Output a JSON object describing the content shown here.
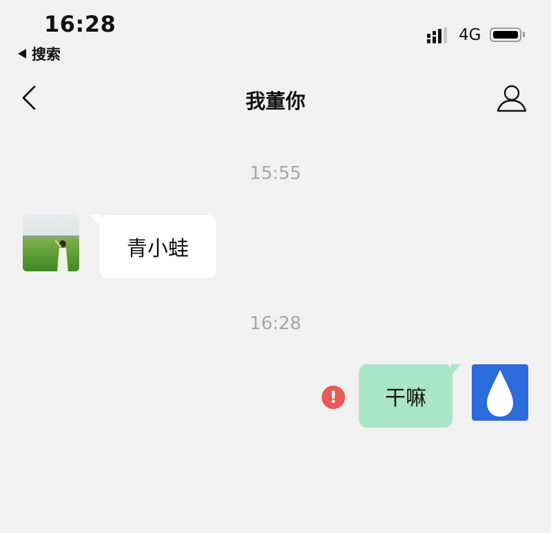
{
  "status_bar": {
    "time": "16:28",
    "back_app_label": "搜索",
    "network": "4G"
  },
  "nav": {
    "title": "我董你"
  },
  "messages": [
    {
      "type": "timestamp",
      "text": "15:55"
    },
    {
      "type": "incoming",
      "text": "青小蛙",
      "avatar": "photo-avatar"
    },
    {
      "type": "timestamp",
      "text": "16:28"
    },
    {
      "type": "outgoing",
      "text": "干嘛",
      "status": "failed",
      "avatar": "water-drop-avatar"
    }
  ],
  "colors": {
    "background": "#f1f1f1",
    "outgoing_bubble": "#a9e5c8",
    "incoming_bubble": "#ffffff",
    "error": "#e85a55",
    "user_avatar": "#2b6bdb"
  }
}
